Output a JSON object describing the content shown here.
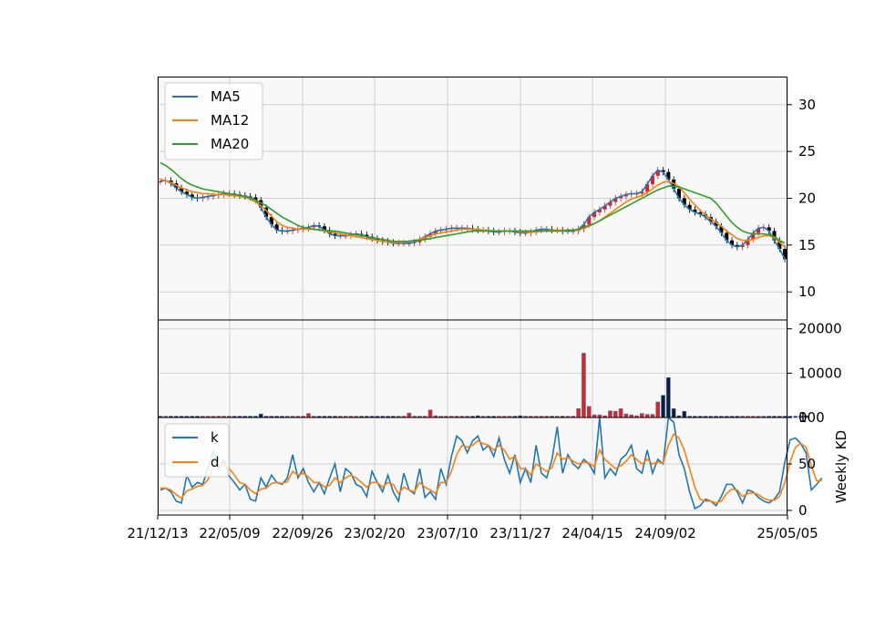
{
  "chart_data": [
    {
      "type": "candlestick",
      "panel": "price",
      "ylim": [
        7,
        33
      ],
      "yticks": [
        10,
        15,
        20,
        25,
        30
      ],
      "grid": true,
      "legend": "top-left",
      "series": [
        {
          "name": "MA5",
          "color": "#1f77b4",
          "values": [
            21.8,
            21.9,
            21.6,
            21.1,
            20.7,
            20.4,
            20.1,
            20.0,
            20.1,
            20.2,
            20.3,
            20.4,
            20.5,
            20.5,
            20.4,
            20.3,
            20.2,
            20.1,
            19.8,
            19.0,
            18.0,
            17.2,
            16.6,
            16.5,
            16.5,
            16.6,
            16.7,
            16.8,
            16.9,
            17.1,
            17.0,
            16.6,
            16.2,
            16.0,
            16.0,
            16.0,
            16.1,
            16.2,
            16.1,
            15.9,
            15.7,
            15.5,
            15.4,
            15.3,
            15.2,
            15.2,
            15.2,
            15.2,
            15.3,
            15.6,
            15.9,
            16.2,
            16.5,
            16.6,
            16.7,
            16.8,
            16.8,
            16.8,
            16.8,
            16.7,
            16.6,
            16.6,
            16.5,
            16.4,
            16.4,
            16.5,
            16.5,
            16.4,
            16.3,
            16.3,
            16.4,
            16.6,
            16.7,
            16.7,
            16.6,
            16.6,
            16.5,
            16.5,
            16.5,
            16.7,
            17.2,
            18.0,
            18.5,
            18.8,
            19.2,
            19.6,
            20.0,
            20.2,
            20.4,
            20.5,
            20.5,
            20.7,
            21.5,
            22.4,
            23.0,
            22.8,
            22.0,
            21.0,
            20.0,
            19.3,
            18.8,
            18.5,
            18.3,
            18.0,
            17.5,
            17.0,
            16.3,
            15.5,
            15.0,
            14.8,
            15.0,
            15.6,
            16.3,
            16.8,
            16.9,
            16.5,
            15.5,
            14.6,
            13.5
          ]
        },
        {
          "name": "MA12",
          "color": "#ff7f0e",
          "values": [
            22.0,
            21.9,
            21.7,
            21.4,
            21.1,
            20.9,
            20.7,
            20.6,
            20.5,
            20.5,
            20.4,
            20.4,
            20.4,
            20.3,
            20.3,
            20.2,
            20.1,
            19.9,
            19.6,
            19.2,
            18.7,
            18.1,
            17.5,
            17.1,
            16.9,
            16.8,
            16.7,
            16.7,
            16.7,
            16.7,
            16.6,
            16.5,
            16.4,
            16.3,
            16.2,
            16.1,
            16.0,
            15.9,
            15.8,
            15.7,
            15.6,
            15.5,
            15.4,
            15.3,
            15.3,
            15.3,
            15.3,
            15.4,
            15.5,
            15.6,
            15.8,
            16.0,
            16.2,
            16.3,
            16.4,
            16.5,
            16.6,
            16.7,
            16.7,
            16.7,
            16.7,
            16.6,
            16.6,
            16.5,
            16.5,
            16.5,
            16.5,
            16.5,
            16.4,
            16.4,
            16.4,
            16.4,
            16.5,
            16.5,
            16.6,
            16.6,
            16.6,
            16.6,
            16.6,
            16.6,
            16.8,
            17.0,
            17.3,
            17.6,
            18.0,
            18.4,
            18.8,
            19.2,
            19.6,
            19.9,
            20.1,
            20.3,
            20.6,
            21.0,
            21.4,
            21.7,
            21.8,
            21.6,
            21.2,
            20.6,
            19.9,
            19.3,
            18.7,
            18.2,
            17.8,
            17.4,
            17.0,
            16.5,
            16.1,
            15.7,
            15.5,
            15.5,
            15.6,
            15.8,
            16.0,
            16.0,
            15.8,
            15.3,
            14.8
          ]
        },
        {
          "name": "MA20",
          "color": "#2ca02c",
          "values": [
            23.8,
            23.5,
            23.1,
            22.6,
            22.1,
            21.7,
            21.4,
            21.2,
            21.0,
            20.9,
            20.8,
            20.7,
            20.6,
            20.5,
            20.4,
            20.3,
            20.2,
            20.0,
            19.8,
            19.5,
            19.2,
            18.8,
            18.4,
            18.0,
            17.7,
            17.4,
            17.1,
            16.9,
            16.8,
            16.7,
            16.6,
            16.6,
            16.5,
            16.5,
            16.4,
            16.3,
            16.2,
            16.1,
            16.0,
            15.9,
            15.8,
            15.7,
            15.6,
            15.5,
            15.4,
            15.4,
            15.4,
            15.4,
            15.5,
            15.5,
            15.6,
            15.7,
            15.8,
            15.9,
            16.0,
            16.1,
            16.2,
            16.3,
            16.4,
            16.5,
            16.5,
            16.5,
            16.5,
            16.5,
            16.5,
            16.5,
            16.5,
            16.5,
            16.5,
            16.5,
            16.5,
            16.5,
            16.5,
            16.5,
            16.5,
            16.5,
            16.5,
            16.6,
            16.6,
            16.7,
            16.9,
            17.1,
            17.3,
            17.6,
            17.9,
            18.2,
            18.5,
            18.8,
            19.1,
            19.4,
            19.7,
            20.0,
            20.3,
            20.6,
            20.9,
            21.1,
            21.3,
            21.3,
            21.2,
            21.0,
            20.8,
            20.6,
            20.4,
            20.2,
            20.0,
            19.5,
            18.8,
            18.1,
            17.4,
            16.9,
            16.5,
            16.3,
            16.2,
            16.2,
            16.2,
            16.1,
            15.9,
            15.5,
            15.2
          ]
        }
      ]
    },
    {
      "type": "bar",
      "panel": "volume",
      "ylim": [
        0,
        22000
      ],
      "yticks": [
        0,
        10000,
        20000
      ],
      "grid": true,
      "values": [
        300,
        300,
        300,
        300,
        300,
        300,
        300,
        300,
        300,
        300,
        300,
        300,
        300,
        300,
        300,
        300,
        300,
        300,
        300,
        800,
        300,
        300,
        300,
        300,
        300,
        300,
        300,
        300,
        900,
        300,
        300,
        300,
        300,
        300,
        300,
        300,
        300,
        300,
        300,
        300,
        300,
        300,
        300,
        300,
        300,
        300,
        300,
        1000,
        300,
        300,
        300,
        1700,
        400,
        300,
        300,
        300,
        300,
        300,
        300,
        300,
        400,
        300,
        300,
        300,
        300,
        300,
        300,
        300,
        400,
        300,
        300,
        300,
        300,
        300,
        300,
        300,
        300,
        300,
        300,
        2000,
        14500,
        2500,
        600,
        600,
        400,
        1500,
        1400,
        2000,
        800,
        600,
        400,
        900,
        700,
        700,
        3500,
        5000,
        9000,
        2000,
        400,
        1400,
        300,
        300,
        300,
        300,
        300,
        300,
        300,
        300,
        300,
        300,
        300,
        300,
        300,
        300,
        300,
        300,
        300,
        300,
        300,
        300,
        300,
        300,
        400
      ]
    },
    {
      "type": "line",
      "panel": "kd",
      "ylabel": "Weekly KD",
      "ylim": [
        -5,
        100
      ],
      "yticks": [
        0,
        50,
        100
      ],
      "grid": true,
      "legend": "top-left",
      "x_ticks": [
        "21/12/13",
        "22/05/09",
        "22/09/26",
        "23/02/20",
        "23/07/10",
        "23/11/27",
        "24/04/15",
        "24/09/02",
        "25/05/05"
      ],
      "series": [
        {
          "name": "k",
          "color": "#1f77b4",
          "values": [
            22,
            24,
            20,
            10,
            8,
            38,
            25,
            30,
            28,
            45,
            64,
            45,
            55,
            37,
            30,
            22,
            28,
            12,
            10,
            35,
            25,
            38,
            30,
            28,
            35,
            60,
            35,
            45,
            30,
            20,
            30,
            18,
            35,
            50,
            20,
            45,
            40,
            28,
            25,
            15,
            42,
            30,
            20,
            38,
            20,
            10,
            40,
            22,
            18,
            45,
            14,
            20,
            12,
            45,
            28,
            58,
            80,
            75,
            62,
            75,
            80,
            65,
            70,
            58,
            78,
            55,
            40,
            60,
            30,
            45,
            30,
            70,
            40,
            35,
            55,
            90,
            40,
            60,
            50,
            45,
            55,
            50,
            40,
            100,
            35,
            45,
            38,
            55,
            60,
            70,
            45,
            40,
            65,
            40,
            55,
            50,
            100,
            95,
            60,
            45,
            20,
            2,
            5,
            12,
            10,
            5,
            15,
            28,
            28,
            20,
            8,
            22,
            20,
            14,
            10,
            8,
            12,
            20,
            52,
            76,
            78,
            72,
            62,
            22,
            28,
            35
          ]
        },
        {
          "name": "d",
          "color": "#ff7f0e",
          "values": [
            24,
            24,
            22,
            17,
            13,
            21,
            23,
            26,
            27,
            33,
            45,
            45,
            50,
            45,
            38,
            30,
            28,
            22,
            18,
            23,
            24,
            29,
            30,
            29,
            31,
            42,
            38,
            40,
            36,
            30,
            30,
            25,
            27,
            35,
            30,
            35,
            38,
            35,
            30,
            25,
            30,
            30,
            25,
            30,
            28,
            18,
            25,
            22,
            20,
            30,
            25,
            22,
            18,
            30,
            30,
            42,
            60,
            70,
            68,
            70,
            75,
            72,
            70,
            65,
            70,
            65,
            55,
            58,
            45,
            45,
            38,
            50,
            46,
            42,
            46,
            62,
            55,
            57,
            53,
            50,
            52,
            51,
            47,
            65,
            55,
            50,
            45,
            48,
            53,
            60,
            55,
            50,
            55,
            50,
            52,
            51,
            70,
            82,
            78,
            65,
            45,
            25,
            12,
            10,
            10,
            8,
            10,
            18,
            23,
            22,
            15,
            18,
            19,
            17,
            13,
            11,
            11,
            15,
            30,
            52,
            68,
            72,
            68,
            48,
            32,
            32
          ]
        }
      ]
    }
  ]
}
